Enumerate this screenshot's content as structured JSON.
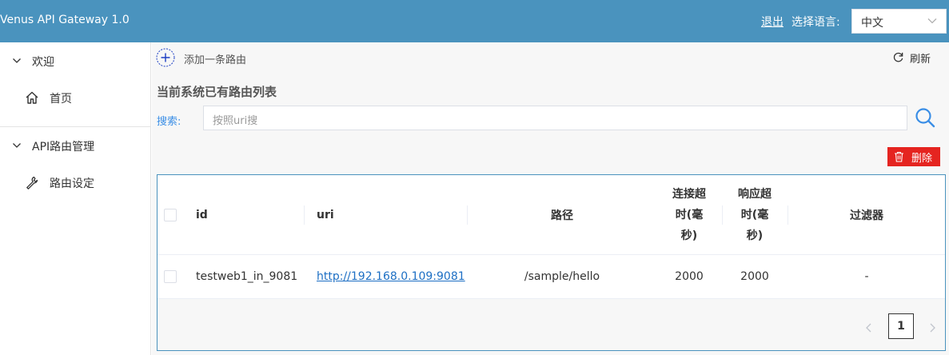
{
  "header": {
    "app_title": "Venus API Gateway 1.0",
    "logout_label": "退出",
    "lang_label": "选择语言:",
    "lang_selected": "中文"
  },
  "sidebar": {
    "groups": [
      {
        "label": "欢迎",
        "chevron_icon": "chevron-down-icon",
        "items": [
          {
            "label": "首页",
            "icon": "home-icon"
          }
        ]
      },
      {
        "label": "API路由管理",
        "chevron_icon": "chevron-down-icon",
        "items": [
          {
            "label": "路由设定",
            "icon": "wrench-icon"
          }
        ]
      }
    ]
  },
  "toolbar": {
    "add_label": "添加一条路由",
    "refresh_label": "刷新"
  },
  "main": {
    "section_title": "当前系统已有路由列表",
    "search_label": "搜索:",
    "search_placeholder": "按照uri搜",
    "delete_label": "删除"
  },
  "table": {
    "columns": [
      "id",
      "uri",
      "路径",
      "连接超时(毫秒)",
      "响应超时(毫秒)",
      "过滤器"
    ],
    "rows": [
      {
        "id": "testweb1_in_9081",
        "uri": "http://192.168.0.109:9081",
        "path": "/sample/hello",
        "connect_timeout": "2000",
        "response_timeout": "2000",
        "filters": "-"
      }
    ]
  },
  "pagination": {
    "current_page": "1"
  },
  "colors": {
    "header_bg": "#4a93be",
    "delete_bg": "#e52420",
    "accent": "#3a8ee6"
  }
}
